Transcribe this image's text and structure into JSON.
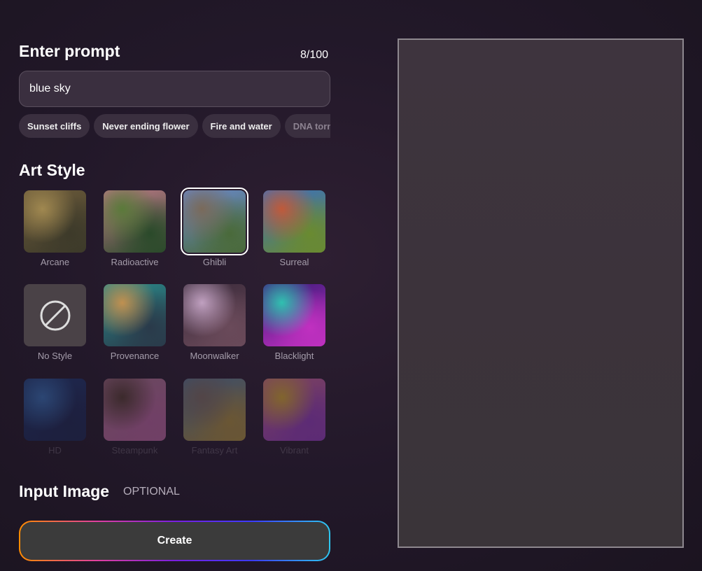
{
  "prompt": {
    "heading": "Enter prompt",
    "counter": "8/100",
    "value": "blue sky"
  },
  "suggestions": [
    "Sunset cliffs",
    "Never ending flower",
    "Fire and water",
    "DNA tornado"
  ],
  "art_style": {
    "heading": "Art Style",
    "selected": "Ghibli",
    "styles": [
      {
        "label": "Arcane",
        "colors": [
          "#6b5a3a",
          "#a08850",
          "#3d3a2a"
        ]
      },
      {
        "label": "Radioactive",
        "colors": [
          "#c07a8a",
          "#5a7a3a",
          "#2a4a2a"
        ]
      },
      {
        "label": "Ghibli",
        "colors": [
          "#6a8ad0",
          "#7a6a5a",
          "#4a6a3a"
        ]
      },
      {
        "label": "Surreal",
        "colors": [
          "#3a70c0",
          "#c05a3a",
          "#6a8a30"
        ]
      },
      {
        "label": "No Style",
        "colors": []
      },
      {
        "label": "Provenance",
        "colors": [
          "#2a8a8a",
          "#c09050",
          "#2a3a4a"
        ]
      },
      {
        "label": "Moonwalker",
        "colors": [
          "#3a2a3a",
          "#c0a0c0",
          "#6a4a5a"
        ]
      },
      {
        "label": "Blacklight",
        "colors": [
          "#3a1a7a",
          "#30c0b0",
          "#c030c0"
        ]
      },
      {
        "label": "HD",
        "colors": [
          "#1a3a7a",
          "#3a80d0",
          "#1a2a5a"
        ]
      },
      {
        "label": "Steampunk",
        "colors": [
          "#c080a0",
          "#5a4030",
          "#d070b0"
        ]
      },
      {
        "label": "Fantasy Art",
        "colors": [
          "#5a8ab0",
          "#8a7a6a",
          "#c0a040"
        ]
      },
      {
        "label": "Vibrant",
        "colors": [
          "#e070a0",
          "#f0c030",
          "#a040d0"
        ]
      }
    ]
  },
  "input_image": {
    "heading": "Input Image",
    "optional": "OPTIONAL"
  },
  "create_label": "Create",
  "icons": {
    "no_style": "prohibited-icon"
  }
}
